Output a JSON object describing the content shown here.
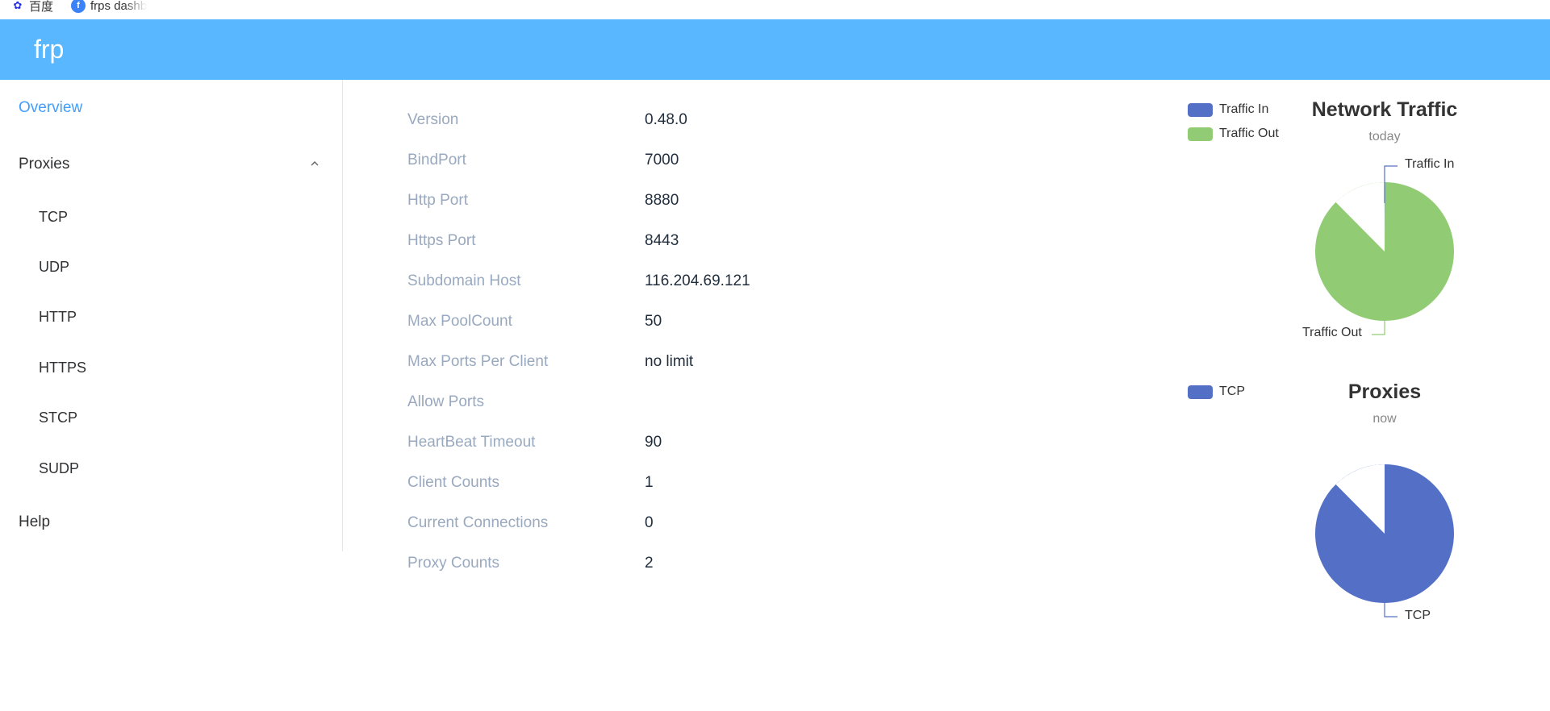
{
  "bookmarks": [
    {
      "label": "百度",
      "icon": "baidu-paw-icon"
    },
    {
      "label": "frps dashb",
      "icon": "frp-favicon-icon"
    }
  ],
  "header": {
    "brand": "frp"
  },
  "sidebar": {
    "overview": "Overview",
    "proxies": "Proxies",
    "proxy_types": [
      "TCP",
      "UDP",
      "HTTP",
      "HTTPS",
      "STCP",
      "SUDP"
    ],
    "help": "Help"
  },
  "info": [
    {
      "label": "Version",
      "value": "0.48.0"
    },
    {
      "label": "BindPort",
      "value": "7000"
    },
    {
      "label": "Http Port",
      "value": "8880"
    },
    {
      "label": "Https Port",
      "value": "8443"
    },
    {
      "label": "Subdomain Host",
      "value": "116.204.69.121"
    },
    {
      "label": "Max PoolCount",
      "value": "50"
    },
    {
      "label": "Max Ports Per Client",
      "value": "no limit"
    },
    {
      "label": "Allow Ports",
      "value": ""
    },
    {
      "label": "HeartBeat Timeout",
      "value": "90"
    },
    {
      "label": "Client Counts",
      "value": "1"
    },
    {
      "label": "Current Connections",
      "value": "0"
    },
    {
      "label": "Proxy Counts",
      "value": "2"
    }
  ],
  "colors": {
    "header": "#58b7ff",
    "active": "#409eff",
    "blue": "#5470c6",
    "green": "#91cc75"
  },
  "chart_data": [
    {
      "type": "pie",
      "title": "Network Traffic",
      "subtitle": "today",
      "legend": [
        "Traffic In",
        "Traffic Out"
      ],
      "categories": [
        "Traffic In",
        "Traffic Out"
      ],
      "values": [
        0.1,
        99.9
      ],
      "colors": [
        "#5470c6",
        "#91cc75"
      ]
    },
    {
      "type": "pie",
      "title": "Proxies",
      "subtitle": "now",
      "legend": [
        "TCP"
      ],
      "categories": [
        "TCP"
      ],
      "values": [
        100
      ],
      "colors": [
        "#5470c6"
      ]
    }
  ]
}
